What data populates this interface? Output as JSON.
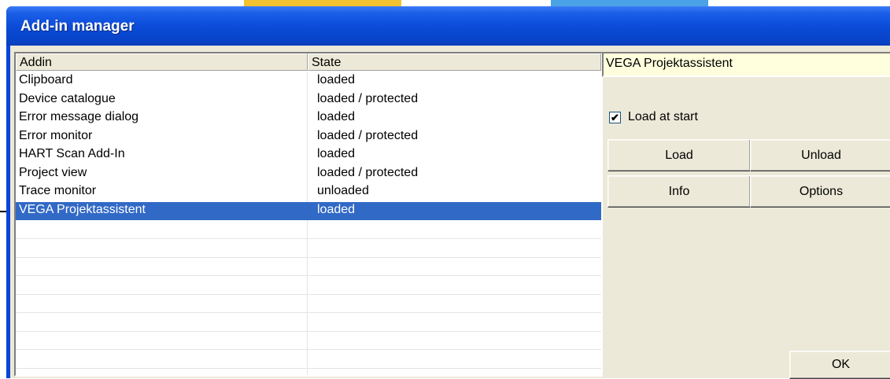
{
  "window": {
    "title": "Add-in manager"
  },
  "list": {
    "columns": [
      "Addin",
      "State"
    ],
    "rows": [
      {
        "addin": "Clipboard",
        "state": "loaded"
      },
      {
        "addin": "Device catalogue",
        "state": "loaded / protected"
      },
      {
        "addin": "Error message dialog",
        "state": "loaded"
      },
      {
        "addin": "Error monitor",
        "state": "loaded / protected"
      },
      {
        "addin": "HART Scan Add-In",
        "state": "loaded"
      },
      {
        "addin": "Project view",
        "state": "loaded / protected"
      },
      {
        "addin": "Trace monitor",
        "state": "unloaded"
      },
      {
        "addin": "VEGA Projektassistent",
        "state": "loaded"
      }
    ],
    "selected_row": "VEGA Projektassistent"
  },
  "details": {
    "name": "VEGA Projektassistent",
    "load_at_start_label": "Load at start",
    "load_at_start_checked": true,
    "checkmark": "✔"
  },
  "buttons": {
    "load": "Load",
    "unload": "Unload",
    "info": "Info",
    "options": "Options",
    "ok": "OK"
  },
  "colors": {
    "titlebar": "#0a45d8",
    "face": "#ece9d8",
    "selection": "#3169c6",
    "name_box": "#ffffdd"
  }
}
